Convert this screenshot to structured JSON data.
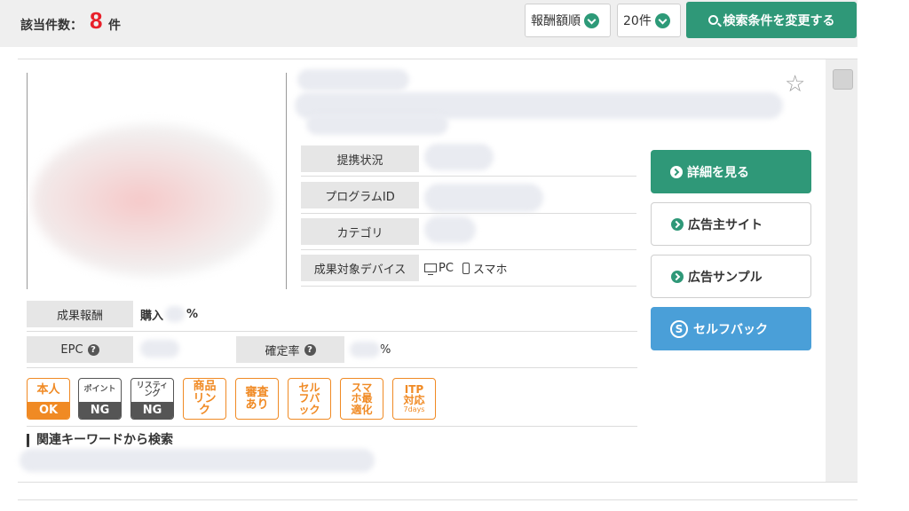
{
  "header": {
    "count_label": "該当件数：",
    "count_value": "8",
    "count_unit": "件",
    "sort_select": "報酬額順",
    "per_page_select": "20件",
    "search_button": "検索条件を変更する"
  },
  "program": {
    "info_rows": [
      {
        "label": "提携状況"
      },
      {
        "label": "プログラムID"
      },
      {
        "label": "カテゴリ"
      },
      {
        "label": "成果対象デバイス",
        "device_pc": "PC",
        "device_sp": "スマホ"
      }
    ],
    "reward": {
      "label": "成果報酬",
      "prefix": "購入",
      "suffix": "%"
    },
    "epc": {
      "label": "EPC",
      "help": "?"
    },
    "confirm_rate": {
      "label": "確定率",
      "help": "?",
      "suffix": "%"
    },
    "actions": {
      "details": "詳細を見る",
      "advertiser_site": "広告主サイト",
      "ad_sample": "広告サンプル",
      "self_back": "セルフバック",
      "self_back_icon": "S"
    },
    "badges": [
      {
        "top": "本人",
        "bottom": "OK",
        "style": "orange-filled"
      },
      {
        "top": "ポイント",
        "bottom": "NG",
        "style": "gray-filled"
      },
      {
        "top": "リスティング",
        "bottom": "NG",
        "style": "gray-filled"
      },
      {
        "top": "商品リンク",
        "style": "orange-outline"
      },
      {
        "top": "審査あり",
        "style": "orange-outline"
      },
      {
        "top": "セルフバック",
        "style": "orange-outline"
      },
      {
        "top": "スマホ最適化",
        "style": "orange-outline"
      },
      {
        "top": "ITP対応",
        "sub": "7days",
        "style": "orange-outline"
      }
    ],
    "keyword_title": "関連キーワードから検索"
  },
  "colors": {
    "accent_green": "#2f9878",
    "accent_blue": "#4a9fd8",
    "badge_orange": "#f08a24",
    "count_red": "#e8202a"
  }
}
